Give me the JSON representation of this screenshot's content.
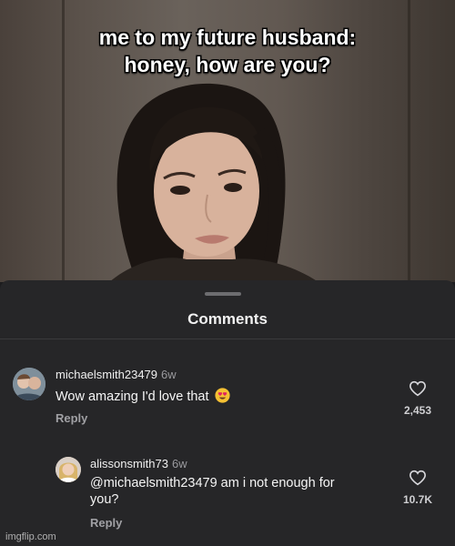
{
  "video": {
    "caption_line1": "me to my future husband:",
    "caption_line2": "honey, how are you?"
  },
  "sheet": {
    "title": "Comments"
  },
  "comments": [
    {
      "username": "michaelsmith23479",
      "time": "6w",
      "text": "Wow amazing I'd love that",
      "emoji": "heart-eyes-emoji",
      "reply_label": "Reply",
      "likes": "2,453"
    },
    {
      "username": "alissonsmith73",
      "time": "6w",
      "text_line1": "@michaelsmith23479 am i not enough for",
      "text_line2": "you?",
      "reply_label": "Reply",
      "likes": "10.7K"
    }
  ],
  "watermark": "imgflip.com",
  "colors": {
    "sheet_bg": "#262628",
    "text": "#f5f5f5",
    "muted": "#9a9a9e"
  }
}
